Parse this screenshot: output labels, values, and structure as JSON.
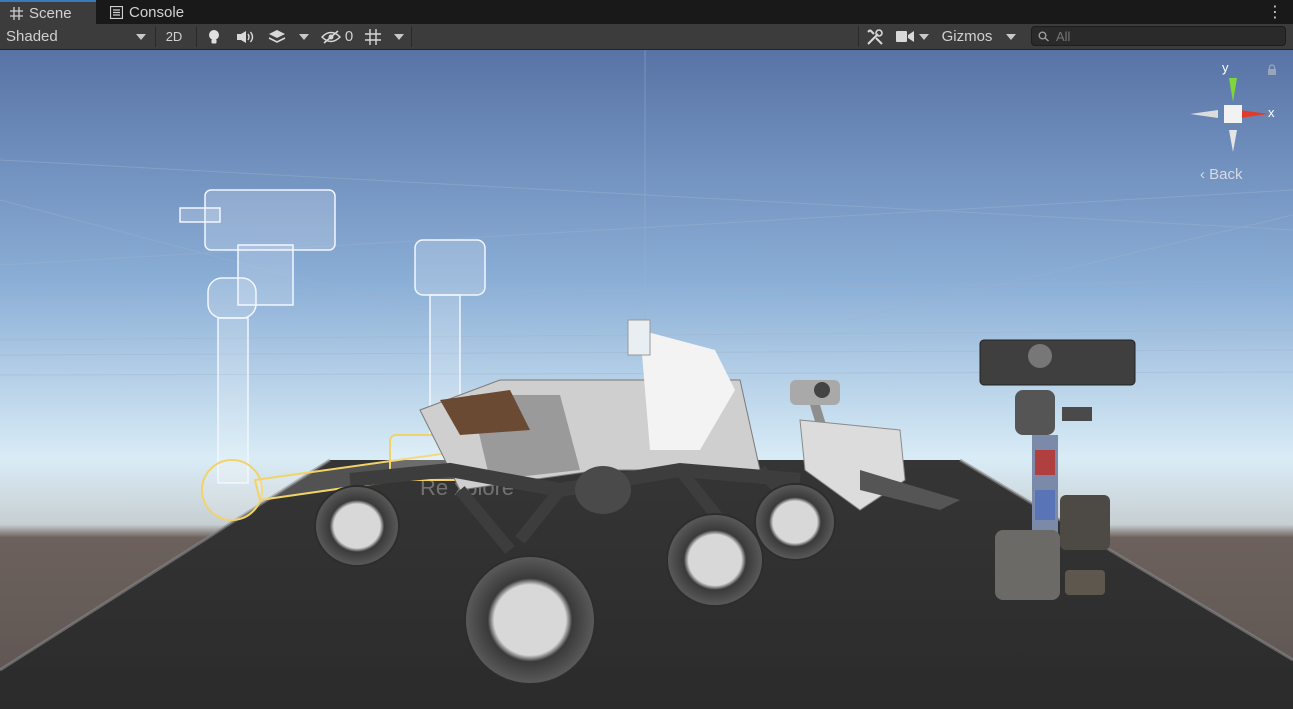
{
  "tabs": [
    {
      "label": "Scene",
      "icon": "grid-icon",
      "active": true
    },
    {
      "label": "Console",
      "icon": "console-icon",
      "active": false
    }
  ],
  "toolbar": {
    "shading_mode": "Shaded",
    "mode_2d": "2D",
    "hidden_count": "0",
    "gizmos_label": "Gizmos",
    "search_placeholder": "All"
  },
  "gizmo": {
    "y_label": "y",
    "x_label": "x",
    "back_label": "Back"
  },
  "colors": {
    "gizmo_y": "#7fd63a",
    "gizmo_x": "#e23a2a",
    "active_tab_accent": "#3a79bb"
  }
}
